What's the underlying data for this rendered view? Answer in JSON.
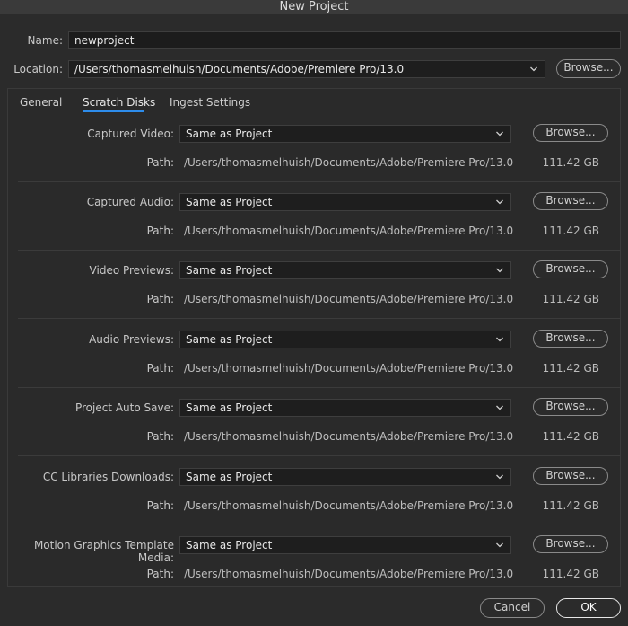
{
  "window": {
    "title": "New Project"
  },
  "name": {
    "label": "Name:",
    "value": "newproject"
  },
  "location": {
    "label": "Location:",
    "value": "/Users/thomasmelhuish/Documents/Adobe/Premiere Pro/13.0",
    "browse_label": "Browse..."
  },
  "tabs": [
    {
      "label": "General",
      "selected": false
    },
    {
      "label": "Scratch Disks",
      "selected": true
    },
    {
      "label": "Ingest Settings",
      "selected": false
    }
  ],
  "scratch_rows": [
    {
      "label": "Captured Video:",
      "value": "Same as Project",
      "browse": "Browse...",
      "path_label": "Path:",
      "path": "/Users/thomasmelhuish/Documents/Adobe/Premiere Pro/13.0",
      "size": "111.42 GB"
    },
    {
      "label": "Captured Audio:",
      "value": "Same as Project",
      "browse": "Browse...",
      "path_label": "Path:",
      "path": "/Users/thomasmelhuish/Documents/Adobe/Premiere Pro/13.0",
      "size": "111.42 GB"
    },
    {
      "label": "Video Previews:",
      "value": "Same as Project",
      "browse": "Browse...",
      "path_label": "Path:",
      "path": "/Users/thomasmelhuish/Documents/Adobe/Premiere Pro/13.0",
      "size": "111.42 GB"
    },
    {
      "label": "Audio Previews:",
      "value": "Same as Project",
      "browse": "Browse...",
      "path_label": "Path:",
      "path": "/Users/thomasmelhuish/Documents/Adobe/Premiere Pro/13.0",
      "size": "111.42 GB"
    },
    {
      "label": "Project Auto Save:",
      "value": "Same as Project",
      "browse": "Browse...",
      "path_label": "Path:",
      "path": "/Users/thomasmelhuish/Documents/Adobe/Premiere Pro/13.0",
      "size": "111.42 GB"
    },
    {
      "label": "CC Libraries Downloads:",
      "value": "Same as Project",
      "browse": "Browse...",
      "path_label": "Path:",
      "path": "/Users/thomasmelhuish/Documents/Adobe/Premiere Pro/13.0",
      "size": "111.42 GB"
    },
    {
      "label": "Motion Graphics Template Media:",
      "value": "Same as Project",
      "browse": "Browse...",
      "path_label": "Path:",
      "path": "/Users/thomasmelhuish/Documents/Adobe/Premiere Pro/13.0",
      "size": "111.42 GB"
    }
  ],
  "footer": {
    "cancel_label": "Cancel",
    "ok_label": "OK"
  },
  "colors": {
    "accent": "#2d8ceb",
    "background": "#2b2b2b",
    "field": "#1c1c1c"
  },
  "icons": {
    "dropdown": "chevron-down-icon"
  }
}
